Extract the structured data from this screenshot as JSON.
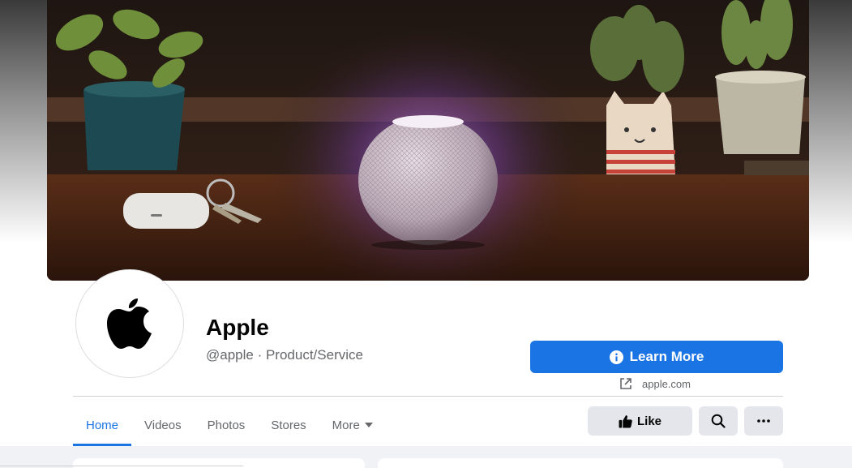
{
  "page": {
    "name": "Apple",
    "handle_category": "@apple · Product/Service"
  },
  "cta": {
    "label": "Learn More",
    "icon": "info-circle-icon"
  },
  "website": {
    "text": "apple.com",
    "icon": "external-link-icon"
  },
  "tabs": [
    {
      "label": "Home",
      "active": true
    },
    {
      "label": "Videos",
      "active": false
    },
    {
      "label": "Photos",
      "active": false
    },
    {
      "label": "Stores",
      "active": false
    },
    {
      "label": "More",
      "active": false,
      "icon": "caret-down-icon"
    }
  ],
  "actions": {
    "like_label": "Like",
    "like_icon": "thumbs-up-icon",
    "search_icon": "search-icon",
    "more_icon": "ellipsis-icon"
  },
  "colors": {
    "accent": "#1b74e4",
    "secondary_button": "#e4e6eb",
    "text_secondary": "#65676b"
  }
}
